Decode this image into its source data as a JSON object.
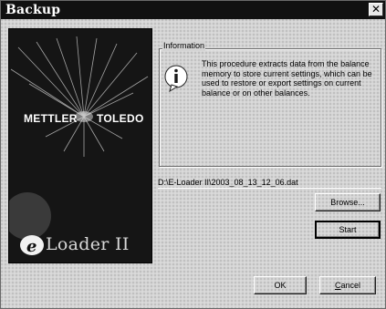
{
  "window": {
    "title": "Backup",
    "close_glyph": "✕"
  },
  "brand": {
    "name_left": "METTLER",
    "name_right": "TOLEDO",
    "product": "Loader II",
    "product_logo_letter": "e"
  },
  "information": {
    "legend": "Information",
    "icon": "info-icon",
    "message": "This procedure extracts data from the balance memory to store current settings, which can be used to restore or export settings on current balance or on other balances."
  },
  "file": {
    "path": "D:\\E-Loader II\\2003_08_13_12_06.dat"
  },
  "buttons": {
    "browse": "Browse...",
    "start": "Start",
    "ok": "OK",
    "cancel_underlined": "C",
    "cancel_rest": "ancel"
  }
}
